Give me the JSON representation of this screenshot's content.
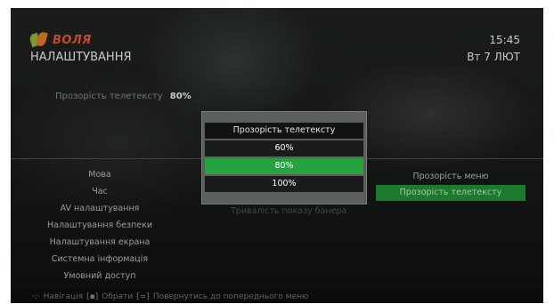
{
  "brand": {
    "logo_text": "ВОЛЯ",
    "logo_icon": "leaf-logo-icon"
  },
  "header": {
    "title": "НАЛАШТУВАННЯ",
    "time": "15:45",
    "date": "Вт 7 ЛЮТ"
  },
  "current_setting": {
    "label": "Прозорість телетексту",
    "value": "80%"
  },
  "menu": {
    "items": [
      {
        "label": "Мова"
      },
      {
        "label": "Час"
      },
      {
        "label": "AV налаштування"
      },
      {
        "label": "Налаштування безпеки"
      },
      {
        "label": "Налаштування екрана"
      },
      {
        "label": "Системна інформація"
      },
      {
        "label": "Умовний доступ"
      }
    ]
  },
  "submenu": {
    "items": [
      {
        "label": "Прозорість меню"
      },
      {
        "label": "Прозорість телетексту",
        "selected": true
      }
    ],
    "hidden_label": "Тривалість показу банера"
  },
  "dialog": {
    "title": "Прозорість телетексту",
    "options": [
      {
        "label": "60%"
      },
      {
        "label": "80%",
        "selected": true
      },
      {
        "label": "100%"
      }
    ]
  },
  "footer": {
    "nav_icon": "arrow-keys-icon",
    "nav_label": "Навігація",
    "ok_icon": "ok-key-icon",
    "ok_label": "Обрати",
    "back_icon": "back-key-icon",
    "back_label": "Повернутись до попереднього меню"
  },
  "colors": {
    "accent": "#23a23e",
    "selected_row": "#1c7a2c",
    "logo": "#c14a35"
  }
}
